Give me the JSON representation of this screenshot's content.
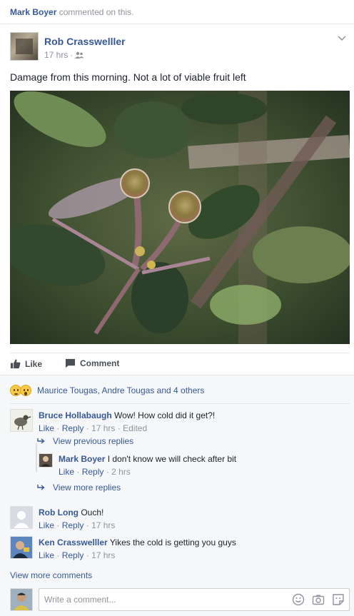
{
  "activity": {
    "actor": "Mark Boyer",
    "action_text": "commented on this."
  },
  "post": {
    "author": "Rob Crasswelller",
    "time": "17 hrs",
    "separator": "·",
    "privacy_icon": "friends-icon",
    "text": "Damage from this morning. Not a lot of viable fruit left"
  },
  "actions": {
    "like_label": "Like",
    "comment_label": "Comment"
  },
  "reactions": {
    "text": "Maurice Tougas, Andre Tougas and 4 others"
  },
  "comments": [
    {
      "author": "Bruce Hollabaugh",
      "text": "Wow! How cold did it get?!",
      "like": "Like",
      "reply": "Reply",
      "time": "17 hrs",
      "edited": "Edited",
      "view_previous": "View previous replies",
      "view_more": "View more replies",
      "reply_item": {
        "author": "Mark Boyer",
        "text": "I don't know we will check after bit",
        "like": "Like",
        "reply": "Reply",
        "time": "2 hrs"
      }
    },
    {
      "author": "Rob Long",
      "text": "Ouch!",
      "like": "Like",
      "reply": "Reply",
      "time": "17 hrs"
    },
    {
      "author": "Ken Crasswelller",
      "text": "Yikes the cold is getting you guys",
      "like": "Like",
      "reply": "Reply",
      "time": "17 hrs"
    }
  ],
  "view_more_comments": "View more comments",
  "composer": {
    "placeholder": "Write a comment..."
  },
  "dot": "·",
  "colors": {
    "link": "#365899",
    "meta": "#90949c",
    "background": "#f6f7f9"
  }
}
